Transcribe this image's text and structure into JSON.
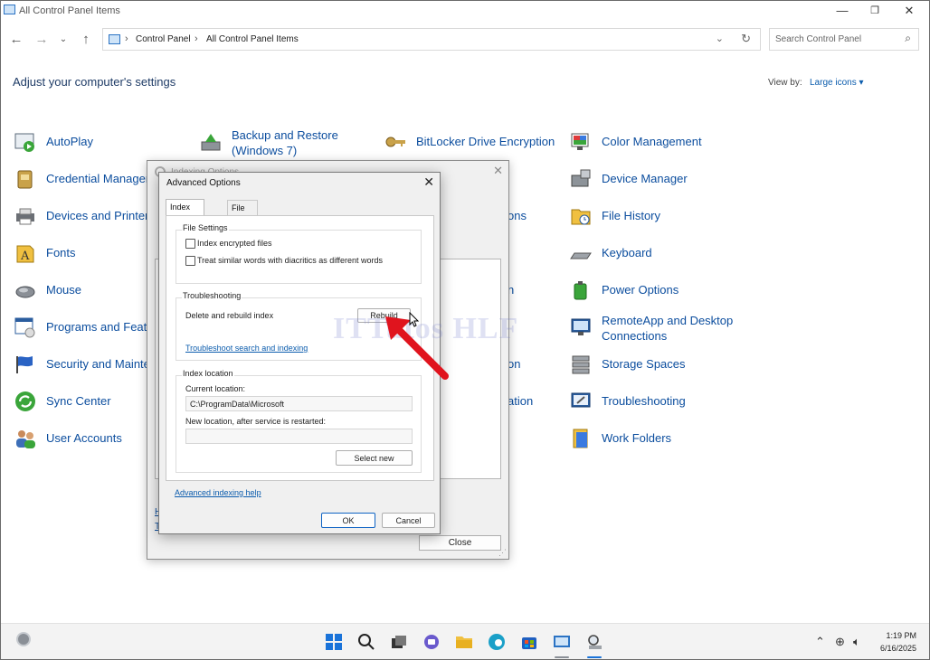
{
  "window": {
    "title": "All Control Panel Items",
    "min_glyph": "—",
    "max_glyph": "❐",
    "close_glyph": "✕"
  },
  "address": {
    "crumbs": [
      "Control Panel",
      "All Control Panel Items"
    ],
    "search_placeholder": "Search Control Panel"
  },
  "header": {
    "title": "Adjust your computer's settings",
    "view_by_label": "View by:",
    "view_by_value": "Large icons"
  },
  "items": {
    "autoplay": "AutoPlay",
    "backup_line1": "Backup and Restore",
    "backup_line2": "(Windows 7)",
    "bitlocker": "BitLocker Drive Encryption",
    "color": "Color Management",
    "credential": "Credential Manager",
    "device_manager": "Device Manager",
    "devices_printers": "Devices and Printers",
    "file_history": "File History",
    "fonts": "Fonts",
    "keyboard": "Keyboard",
    "mouse": "Mouse",
    "power": "Power Options",
    "programs": "Programs and Featu",
    "remoteapp_line1": "RemoteApp and Desktop",
    "remoteapp_line2": "Connections",
    "security": "Security and Mainte",
    "storage": "Storage Spaces",
    "sync": "Sync Center",
    "troubleshooting": "Troubleshooting",
    "user_accounts": "User Accounts",
    "work_folders": "Work Folders",
    "col3_r3": "ons",
    "col3_r5": "n",
    "col3_r7": "on",
    "col3_r8": "ation"
  },
  "indexing": {
    "title": "Indexing Options",
    "letter": "In",
    "link1": "H",
    "link2": "T",
    "close_label": "Close"
  },
  "advanced": {
    "title": "Advanced Options",
    "tabs": [
      "Index Settings",
      "File Types"
    ],
    "file_settings": {
      "title": "File Settings",
      "opt1": "Index encrypted files",
      "opt2": "Treat similar words with diacritics as different words"
    },
    "troubleshooting": {
      "title": "Troubleshooting",
      "label": "Delete and rebuild index",
      "rebuild": "Rebuild",
      "link": "Troubleshoot search and indexing"
    },
    "index_location": {
      "title": "Index location",
      "current_label": "Current location:",
      "current_value": "C:\\ProgramData\\Microsoft",
      "new_label": "New location, after service is restarted:",
      "new_value": "",
      "select_new": "Select new"
    },
    "help_link": "Advanced indexing help",
    "ok": "OK",
    "cancel": "Cancel"
  },
  "watermark": "ITTutos HLF",
  "colors": {
    "link_blue": "#0b4d9e",
    "accent": "#0e63c4",
    "arrow_red": "#e0141e"
  },
  "taskbar": {
    "time": "1:19 PM",
    "date": "6/16/2025"
  }
}
